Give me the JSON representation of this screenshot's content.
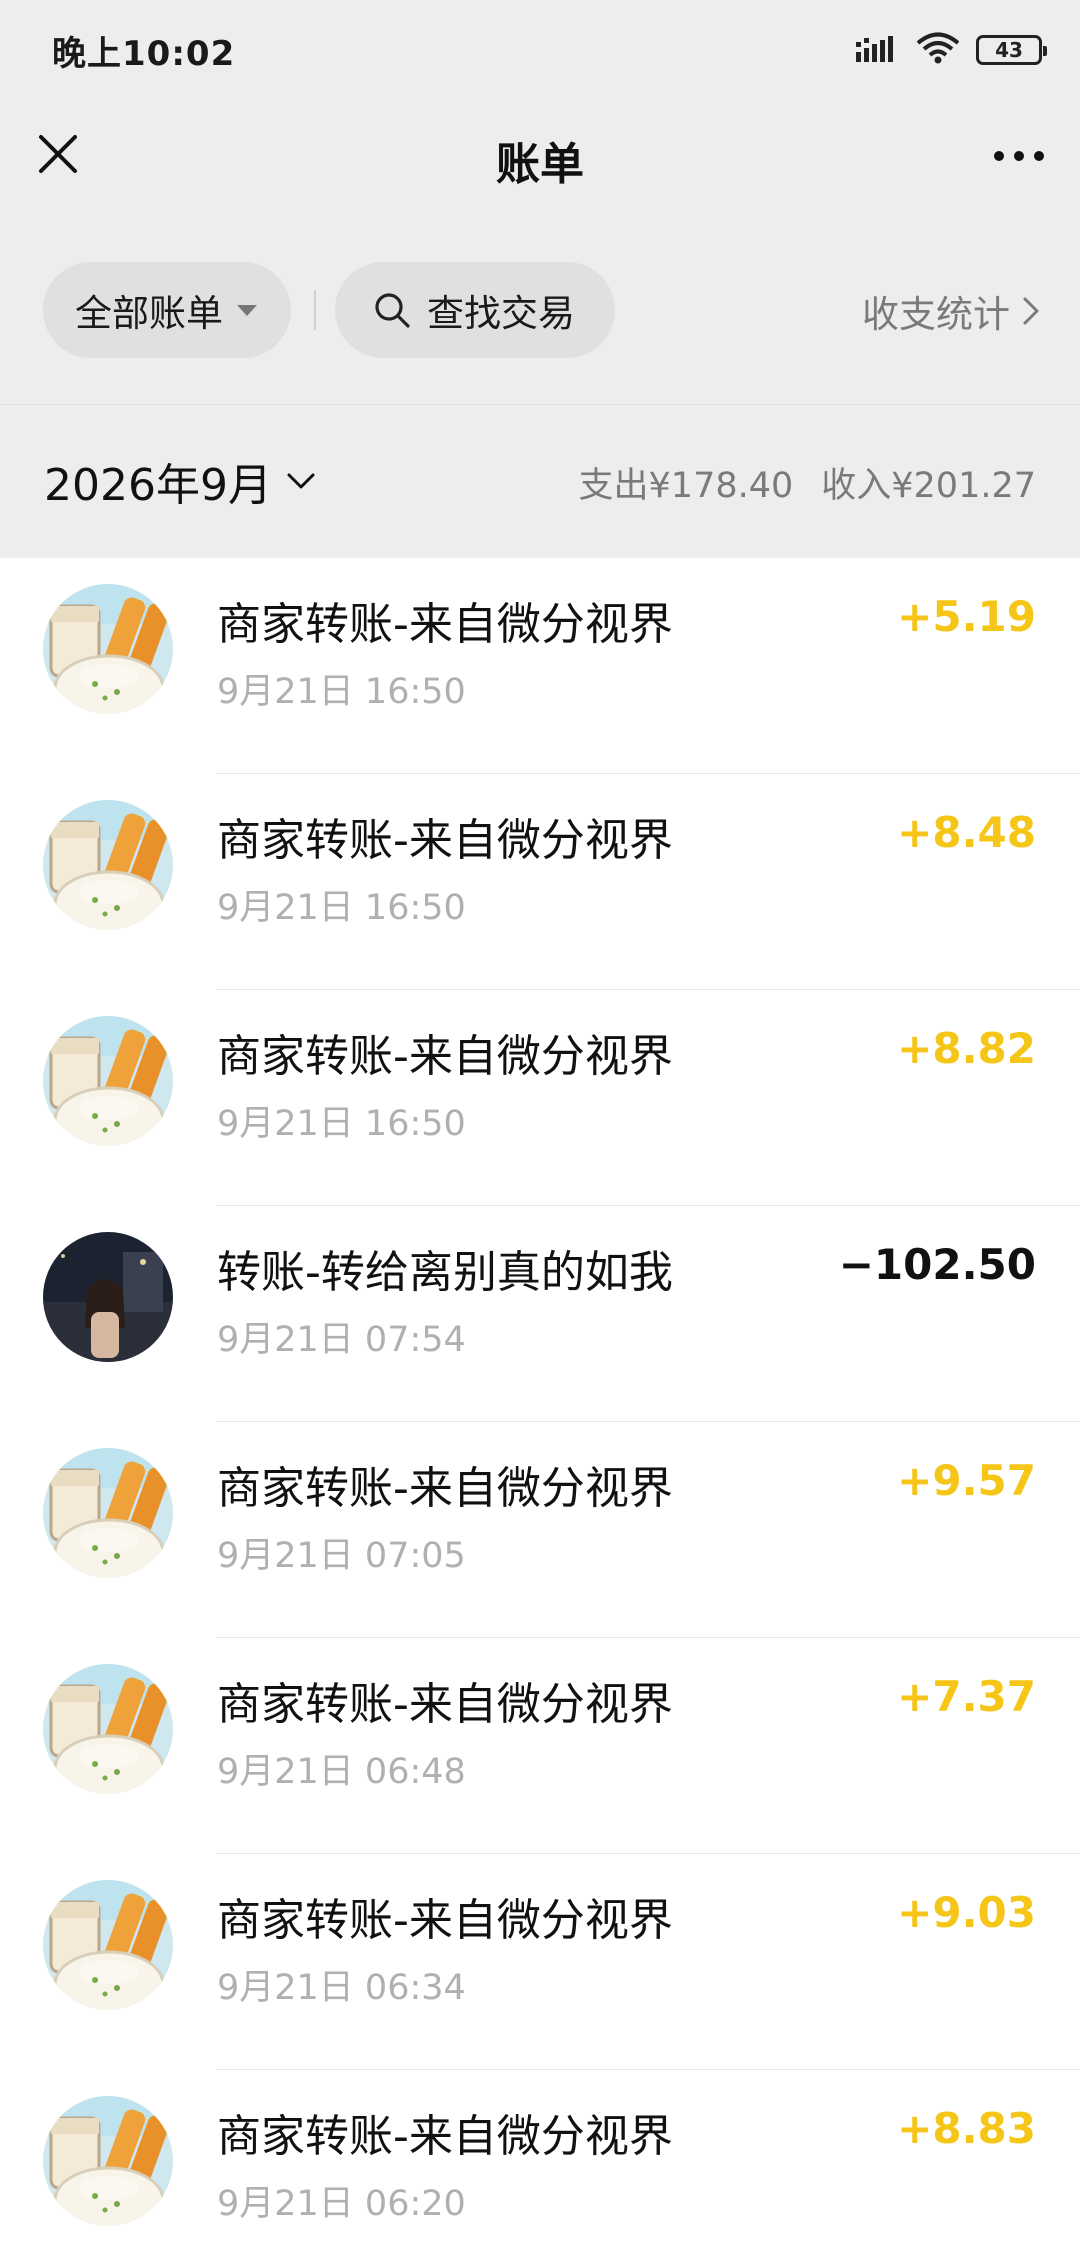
{
  "status_bar": {
    "time": "晚上10:02",
    "battery": "43",
    "icons": [
      "signal-icon",
      "wifi-icon",
      "battery-icon"
    ]
  },
  "nav": {
    "title": "账单",
    "close_icon": "close-icon",
    "more_icon": "more-icon"
  },
  "filters": {
    "all_bills_label": "全部账单",
    "search_label": "查找交易",
    "stats_label": "收支统计"
  },
  "month": {
    "label": "2026年9月",
    "expense": "支出¥178.40",
    "income": "收入¥201.27"
  },
  "colors": {
    "income": "#f5c518",
    "expense": "#111111",
    "top_bg": "#ededed"
  },
  "transactions": [
    {
      "title": "商家转账-来自微分视界",
      "time": "9月21日 16:50",
      "amount": "+5.19",
      "kind": "income",
      "avatar": "food-avatar"
    },
    {
      "title": "商家转账-来自微分视界",
      "time": "9月21日 16:50",
      "amount": "+8.48",
      "kind": "income",
      "avatar": "food-avatar"
    },
    {
      "title": "商家转账-来自微分视界",
      "time": "9月21日 16:50",
      "amount": "+8.82",
      "kind": "income",
      "avatar": "food-avatar"
    },
    {
      "title": "转账-转给离别真的如我",
      "time": "9月21日 07:54",
      "amount": "−102.50",
      "kind": "expense",
      "avatar": "person-avatar"
    },
    {
      "title": "商家转账-来自微分视界",
      "time": "9月21日 07:05",
      "amount": "+9.57",
      "kind": "income",
      "avatar": "food-avatar"
    },
    {
      "title": "商家转账-来自微分视界",
      "time": "9月21日 06:48",
      "amount": "+7.37",
      "kind": "income",
      "avatar": "food-avatar"
    },
    {
      "title": "商家转账-来自微分视界",
      "time": "9月21日 06:34",
      "amount": "+9.03",
      "kind": "income",
      "avatar": "food-avatar"
    },
    {
      "title": "商家转账-来自微分视界",
      "time": "9月21日 06:20",
      "amount": "+8.83",
      "kind": "income",
      "avatar": "food-avatar"
    }
  ]
}
